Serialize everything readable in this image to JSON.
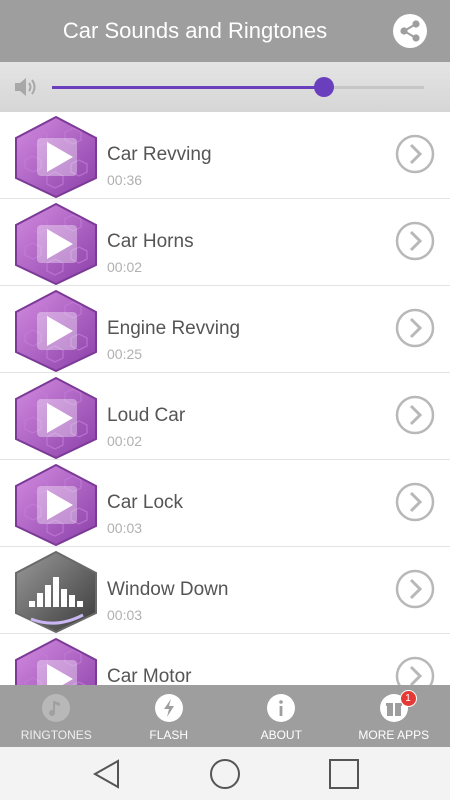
{
  "header": {
    "title": "Car Sounds and Ringtones",
    "share_icon": "share-icon"
  },
  "volume": {
    "icon": "speaker-icon",
    "level": 0.73,
    "color": "#6a3fbe"
  },
  "sounds": [
    {
      "name": "Car Revving",
      "duration": "00:36",
      "icon": "play-hexagon-icon"
    },
    {
      "name": "Car Horns",
      "duration": "00:02",
      "icon": "play-hexagon-icon"
    },
    {
      "name": "Engine Revving",
      "duration": "00:25",
      "icon": "play-hexagon-icon"
    },
    {
      "name": "Loud Car",
      "duration": "00:02",
      "icon": "play-hexagon-icon"
    },
    {
      "name": "Car Lock",
      "duration": "00:03",
      "icon": "play-hexagon-icon"
    },
    {
      "name": "Window Down",
      "duration": "00:03",
      "icon": "equalizer-hexagon-icon"
    },
    {
      "name": "Car Motor",
      "duration": "",
      "icon": "play-hexagon-icon"
    }
  ],
  "bottom_nav": [
    {
      "label": "RINGTONES",
      "icon": "music-note-icon"
    },
    {
      "label": "FLASH",
      "icon": "lightning-icon"
    },
    {
      "label": "ABOUT",
      "icon": "info-icon"
    },
    {
      "label": "MORE APPS",
      "icon": "gift-icon",
      "badge": "1"
    }
  ],
  "colors": {
    "header": "#9e9e9e",
    "accent": "#6a3fbe",
    "badge": "#e53935"
  }
}
